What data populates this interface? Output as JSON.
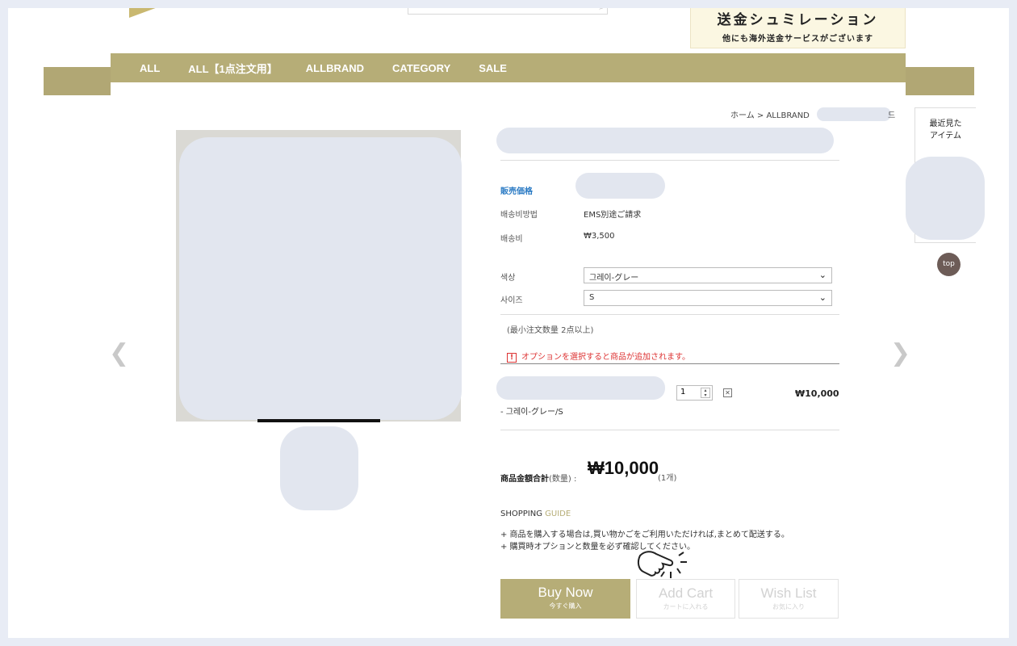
{
  "header": {
    "logo_text": "",
    "banner_title": "送金シュミレーション",
    "banner_sub": "他にも海外送金サービスがございます"
  },
  "nav": {
    "items": [
      "ALL",
      "ALL【1点注文用】",
      "ALLBRAND",
      "CATEGORY",
      "SALE"
    ]
  },
  "breadcrumb": {
    "home": "ホーム",
    "sep": ">",
    "section": "ALLBRAND",
    "tail": "드"
  },
  "product": {
    "price_label": "販売価格",
    "shipping_method_label": "배송비방법",
    "shipping_method_value": "EMS別途ご請求",
    "shipping_fee_label": "배송비",
    "shipping_fee_value": "₩3,500",
    "color_label": "색상",
    "color_value": "그레이-グレー",
    "size_label": "사이즈",
    "size_value": "S",
    "min_order": "(最小注文数量 2点以上)",
    "option_warning": "オプションを選択すると商品が追加されます。",
    "option_line_value": "- 그레이-グレー/S",
    "quantity": "1",
    "line_price": "₩10,000",
    "total_label": "商品金額合計",
    "total_label_suffix": "(数量) :",
    "total_value": "₩10,000",
    "total_count": "(1개)"
  },
  "guide": {
    "title_main": "SHOPPING ",
    "title_accent": "GUIDE",
    "line1": "+ 商品を購入する場合は,買い物かごをご利用いただければ,まとめて配送する。",
    "line2": "+ 購買時オプションと数量を必ず確認してください。"
  },
  "buttons": {
    "buy_now": "Buy Now",
    "buy_now_sub": "今すぐ購入",
    "add_cart": "Add Cart",
    "add_cart_sub": "カートに入れる",
    "wish_list": "Wish List",
    "wish_list_sub": "お気に入り"
  },
  "sidebar": {
    "recent_title_1": "最近見た",
    "recent_title_2": "アイテム",
    "top": "top"
  },
  "colors": {
    "accent": "#b6ad77",
    "warning": "#dd3333",
    "price_label": "#2a7ac4"
  },
  "icons": [
    "search-icon",
    "chevron-left-icon",
    "chevron-right-icon",
    "chevron-down-icon",
    "warning-icon",
    "delete-icon",
    "hand-pointer-icon"
  ]
}
